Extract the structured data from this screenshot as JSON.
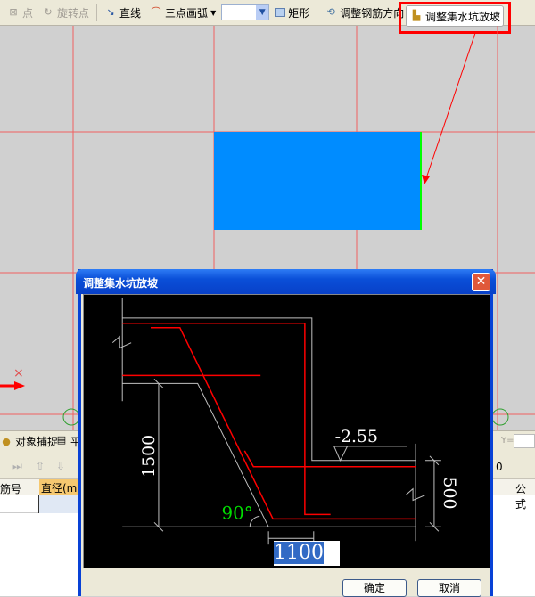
{
  "toolbar": {
    "point": "点",
    "rotate_point": "旋转点",
    "line": "直线",
    "arc": "三点画弧",
    "combo_value": "",
    "rect": "矩形",
    "adjust_rebar_dir": "调整钢筋方向",
    "adjust_pit_slope": "调整集水坑放坡"
  },
  "lower": {
    "snap": "对象捕捉",
    "snap2": "平",
    "y_label": "Y=",
    "col_rebar_no": "筋号",
    "col_diameter": "直径(mm)",
    "col_formula": "公式",
    "value_zero": "0"
  },
  "dialog": {
    "title": "调整集水坑放坡",
    "dims": {
      "height": "1500",
      "depth": "500",
      "elevation": "-2.55",
      "angle": "90°"
    },
    "input_value": "1100",
    "ok": "确定",
    "cancel": "取消"
  },
  "colors": {
    "accent": "#ff0000",
    "slab": "#008cff",
    "title": "#0a4fd8"
  }
}
